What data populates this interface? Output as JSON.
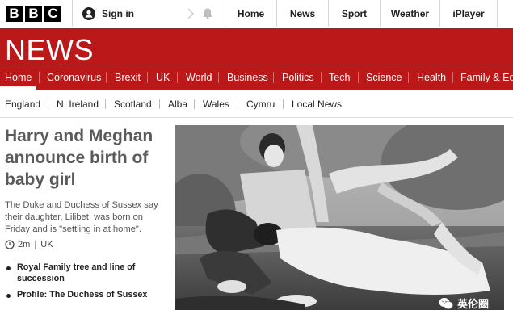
{
  "brand": {
    "letters": [
      "B",
      "B",
      "C"
    ],
    "news_title": "NEWS"
  },
  "account": {
    "signin_label": "Sign in"
  },
  "top_nav": [
    "Home",
    "News",
    "Sport",
    "Weather",
    "iPlayer"
  ],
  "main_nav": {
    "active": "Home",
    "items": [
      "Home",
      "Coronavirus",
      "Brexit",
      "UK",
      "World",
      "Business",
      "Politics",
      "Tech",
      "Science",
      "Health",
      "Family & Edu"
    ]
  },
  "sub_nav": [
    "England",
    "N. Ireland",
    "Scotland",
    "Alba",
    "Wales",
    "Cymru",
    "Local News"
  ],
  "story": {
    "headline": "Harry and Meghan announce birth of baby girl",
    "summary": "The Duke and Duchess of Sussex say their daughter, Lilibet, was born on Friday and is \"settling in at home\".",
    "time_ago": "2m",
    "section": "UK",
    "related": [
      "Royal Family tree and line of succession",
      "Profile: The Duchess of Sussex"
    ]
  },
  "watermark": {
    "label": "英伦圈"
  },
  "colors": {
    "brand_red": "#bb1919",
    "text_dark": "#222222",
    "headline_grey": "#5a5a5a"
  },
  "icons": {
    "user": "user-icon",
    "chevron": "chevron-right-icon",
    "bell": "bell-icon",
    "clock": "clock-icon",
    "wechat": "wechat-icon"
  }
}
